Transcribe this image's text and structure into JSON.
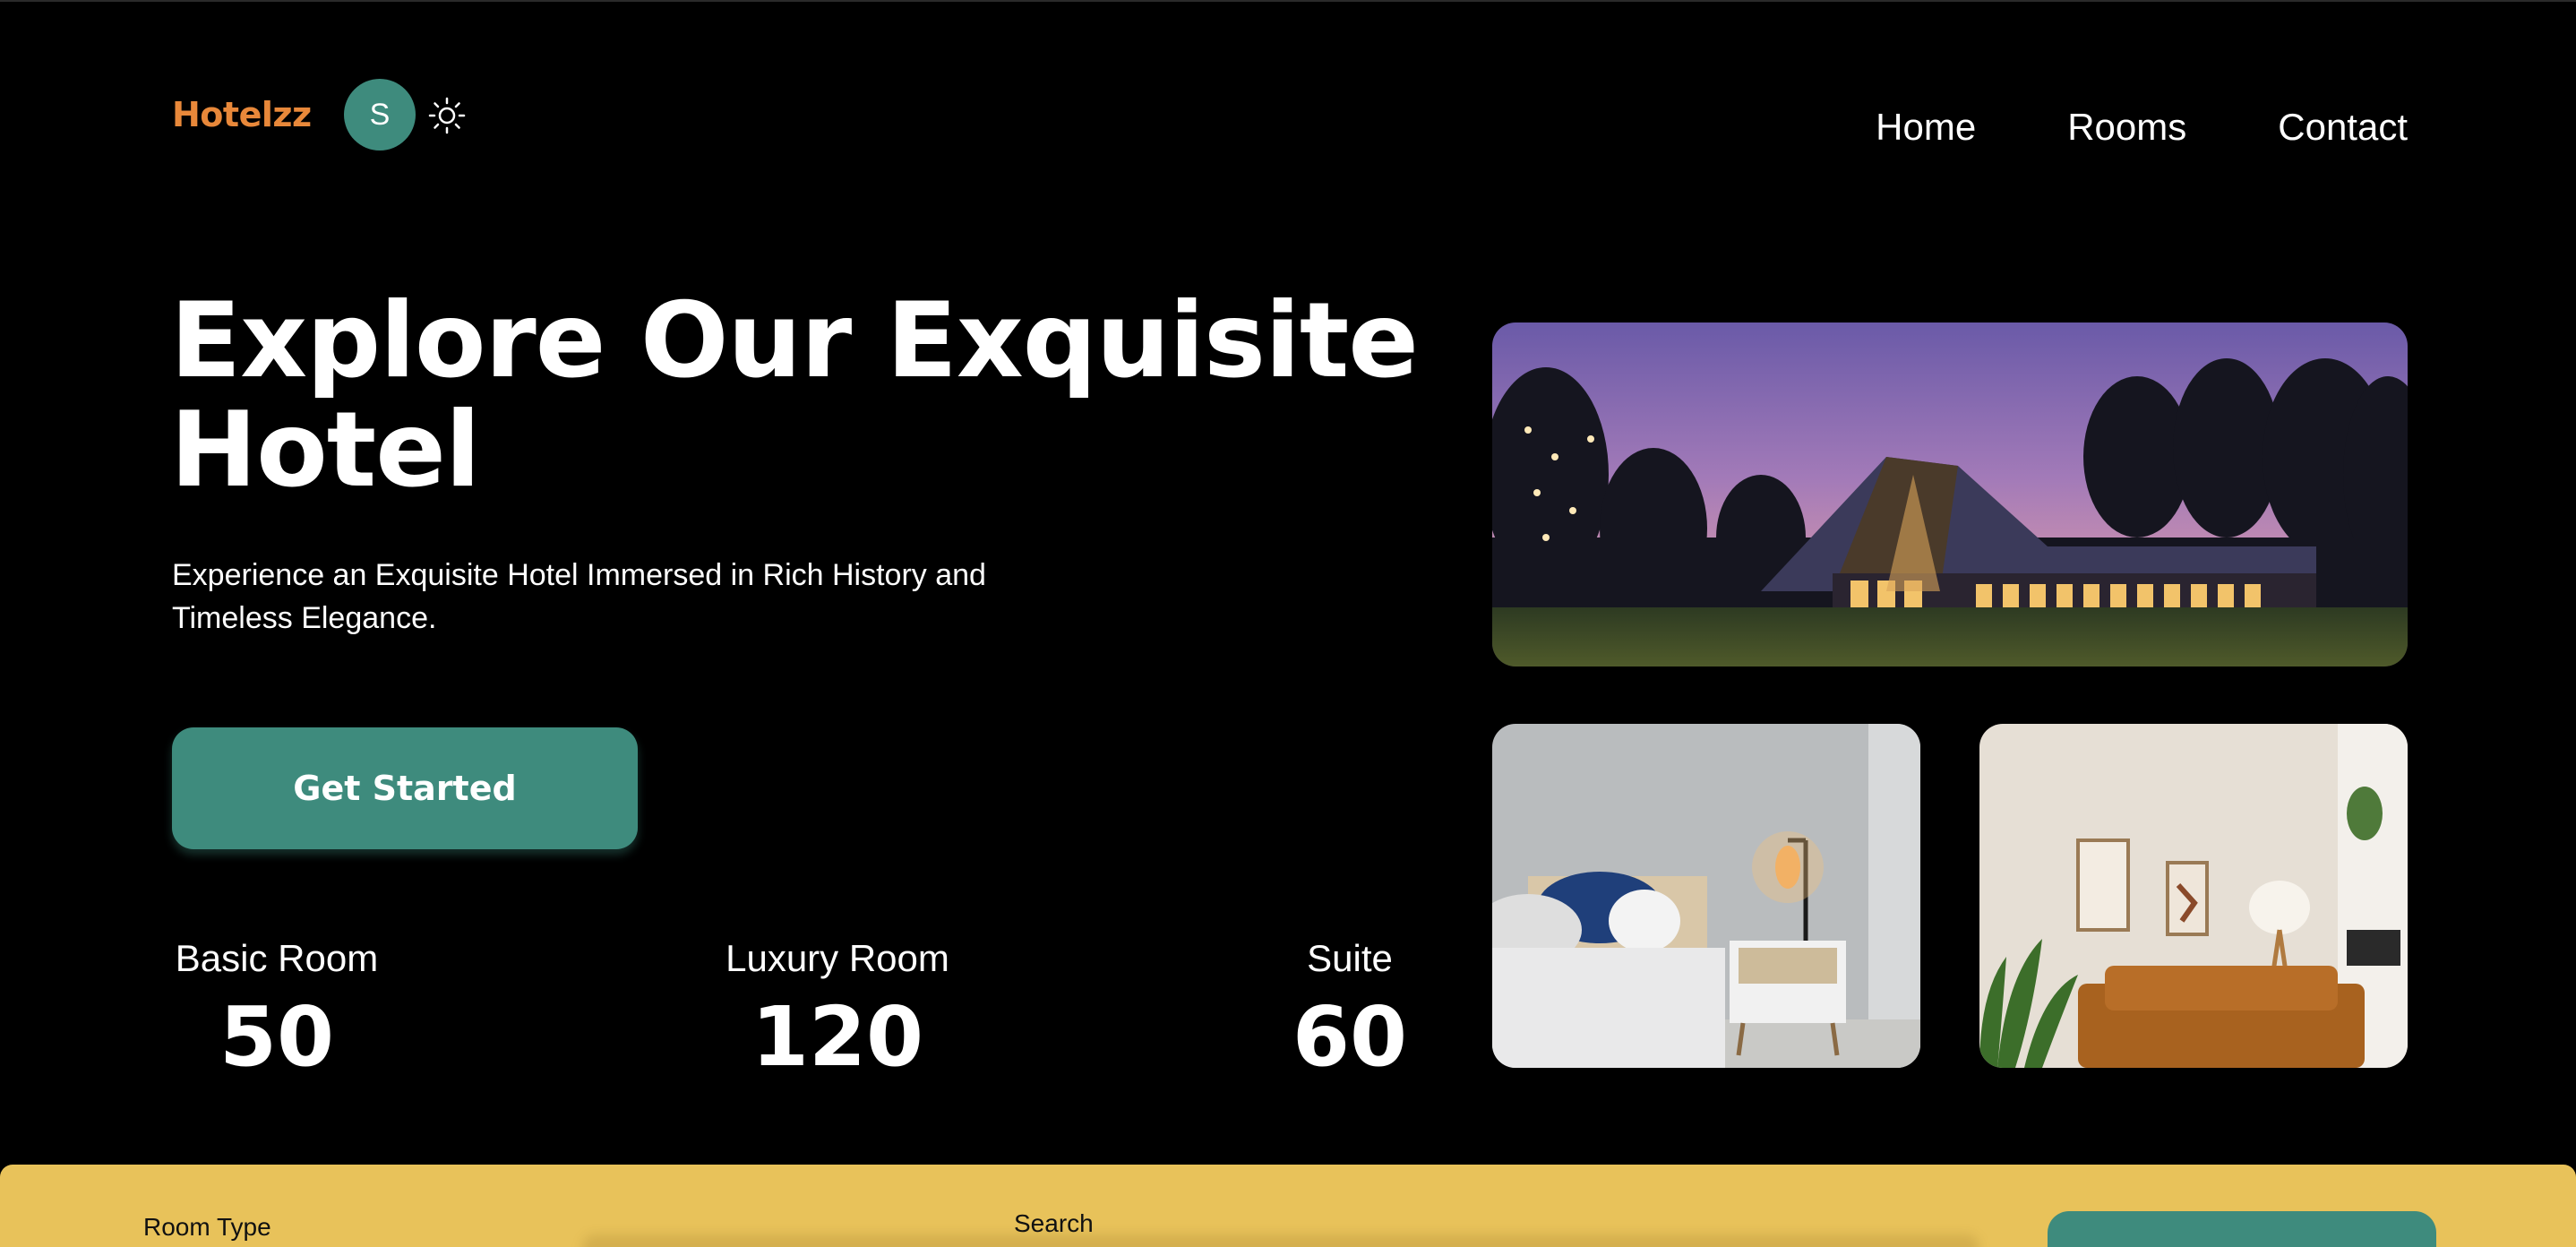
{
  "header": {
    "logo": "Hotelzz",
    "avatar_initial": "S",
    "theme_toggle_icon": "sun-icon",
    "nav": [
      {
        "label": "Home"
      },
      {
        "label": "Rooms"
      },
      {
        "label": "Contact"
      }
    ]
  },
  "hero": {
    "title": "Explore Our Exquisite Hotel",
    "subtitle": "Experience an Exquisite Hotel Immersed in Rich History and Timeless Elegance.",
    "cta_label": "Get Started"
  },
  "stats": [
    {
      "label": "Basic Room",
      "value": "50"
    },
    {
      "label": "Luxury Room",
      "value": "120"
    },
    {
      "label": "Suite",
      "value": "60"
    }
  ],
  "images": {
    "hotel": "hotel-exterior-photo",
    "bedroom": "bedroom-photo",
    "living": "living-room-photo"
  },
  "booking": {
    "room_type_label": "Room Type",
    "search_label": "Search"
  },
  "colors": {
    "background": "#000000",
    "brand": "#e8883a",
    "accent": "#3e8b7d",
    "booking_bar": "#e8c25a"
  }
}
